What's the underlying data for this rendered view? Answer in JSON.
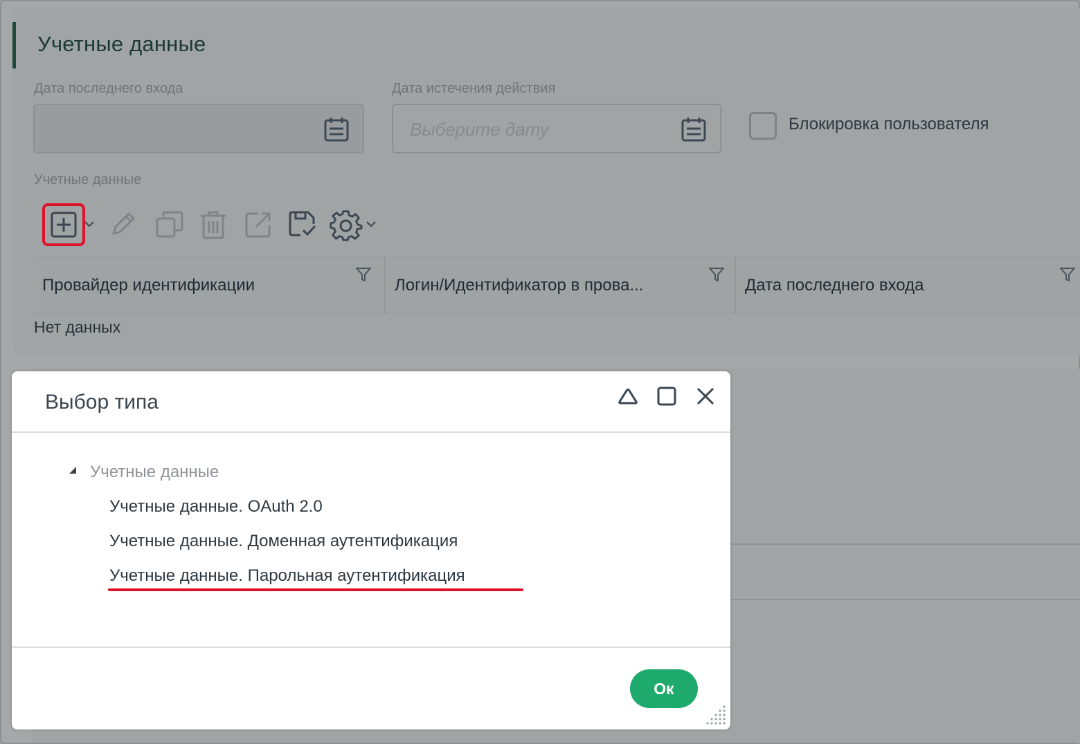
{
  "section": {
    "title": "Учетные данные",
    "last_login_label": "Дата последнего входа",
    "expiry_label": "Дата истечения действия",
    "expiry_placeholder": "Выберите дату",
    "block_user_label": "Блокировка пользователя",
    "credentials_label": "Учетные данные"
  },
  "toolbar": {
    "icons": [
      "add-icon",
      "edit-icon",
      "copy-icon",
      "delete-icon",
      "open-external-icon",
      "save-check-icon",
      "settings-icon"
    ]
  },
  "table": {
    "columns": [
      "Провайдер идентификации",
      "Логин/Идентификатор в прова...",
      "Дата последнего входа"
    ],
    "empty_text": "Нет данных"
  },
  "modal": {
    "title": "Выбор типа",
    "tree_root": "Учетные данные",
    "tree_items": [
      "Учетные данные. OAuth 2.0",
      "Учетные данные. Доменная аутентификация",
      "Учетные данные. Парольная аутентификация"
    ],
    "ok_label": "Ок"
  },
  "colors": {
    "accent_green": "#1eaa6d",
    "highlight_red": "#e0102a",
    "title_green": "#1d3a30"
  }
}
